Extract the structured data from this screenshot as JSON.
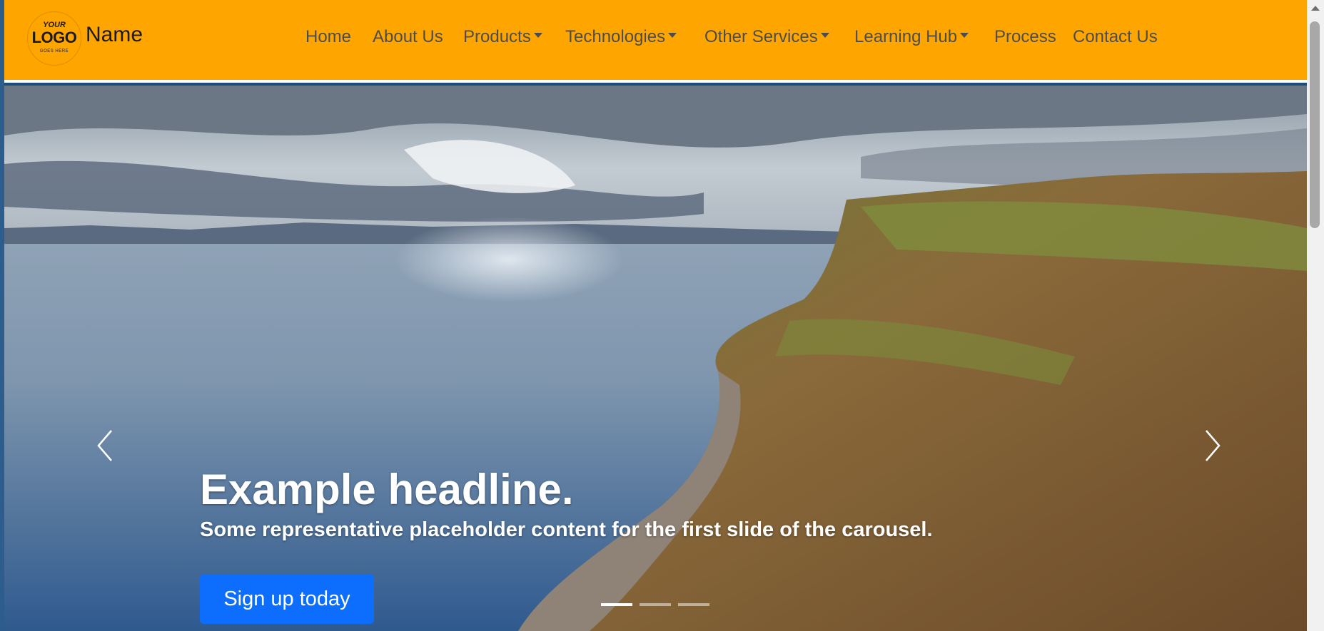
{
  "brand": {
    "logo_line1": "YOUR",
    "logo_line2": "LOGO",
    "logo_line3": "GOES HERE",
    "name": "Name"
  },
  "nav": {
    "items": [
      {
        "label": "Home",
        "dropdown": false
      },
      {
        "label": "About Us",
        "dropdown": false
      },
      {
        "label": "Products",
        "dropdown": true
      },
      {
        "label": "Technologies",
        "dropdown": true
      },
      {
        "label": "Other Services",
        "dropdown": true
      },
      {
        "label": "Learning Hub",
        "dropdown": true
      },
      {
        "label": "Process",
        "dropdown": false
      },
      {
        "label": "Contact Us",
        "dropdown": false
      }
    ]
  },
  "carousel": {
    "headline": "Example headline.",
    "subline": "Some representative placeholder content for the first slide of the carousel.",
    "cta_label": "Sign up today",
    "slide_count": 3,
    "active_slide": 1,
    "prev_icon": "chevron-left-icon",
    "next_icon": "chevron-right-icon"
  },
  "colors": {
    "navbar": "#ffa500",
    "cta": "#0d6efd",
    "nav_text": "#4d4d4d"
  }
}
